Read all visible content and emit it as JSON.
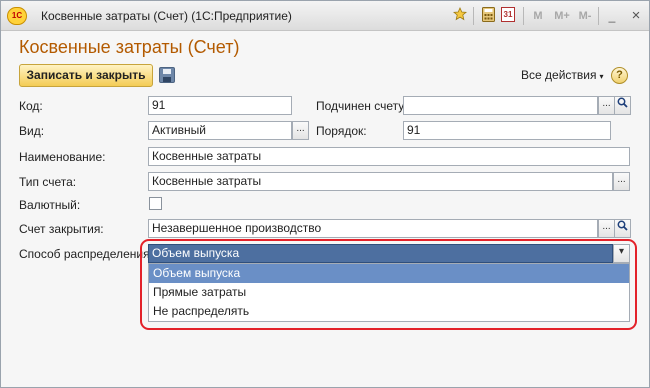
{
  "window": {
    "logo": "1С",
    "title": "Косвенные затраты (Счет)  (1С:Предприятие)",
    "toolbar": {
      "favorite_icon": "star-icon",
      "calc_icon": "calculator-icon",
      "calendar_icon": "calendar-icon",
      "calendar_glyph": "31",
      "m_label": "M",
      "mplus_label": "M+",
      "mminus_label": "M-",
      "minimize_glyph": "_",
      "maximize_glyph": "□",
      "close_glyph": "×"
    }
  },
  "form": {
    "title": "Косвенные затраты (Счет)",
    "save_close_label": "Записать и закрыть",
    "save_icon": "floppy-icon",
    "all_actions_label": "Все действия",
    "all_actions_caret": "▾",
    "help_glyph": "?"
  },
  "fields": {
    "code_label": "Код:",
    "code_value": "91",
    "parent_label": "Подчинен счету:",
    "parent_value": "",
    "type_label": "Вид:",
    "type_value": "Активный",
    "order_label": "Порядок:",
    "order_value": "91",
    "name_label": "Наименование:",
    "name_value": "Косвенные затраты",
    "account_type_label": "Тип счета:",
    "account_type_value": "Косвенные затраты",
    "currency_label": "Валютный:",
    "closing_label": "Счет закрытия:",
    "closing_value": "Незавершенное производство",
    "distribution_label": "Способ распределения:",
    "distribution_value": "Объем выпуска",
    "select_glyph": "...",
    "search_icon": "magnifier-icon",
    "dropdown_glyph": "▾"
  },
  "dropdown": {
    "options": [
      "Объем выпуска",
      "Прямые затраты",
      "Не распределять"
    ],
    "selected_index": 0
  },
  "colors": {
    "title_accent": "#b35a00",
    "selection": "#6a8fc6",
    "highlight": "#e3222a"
  }
}
